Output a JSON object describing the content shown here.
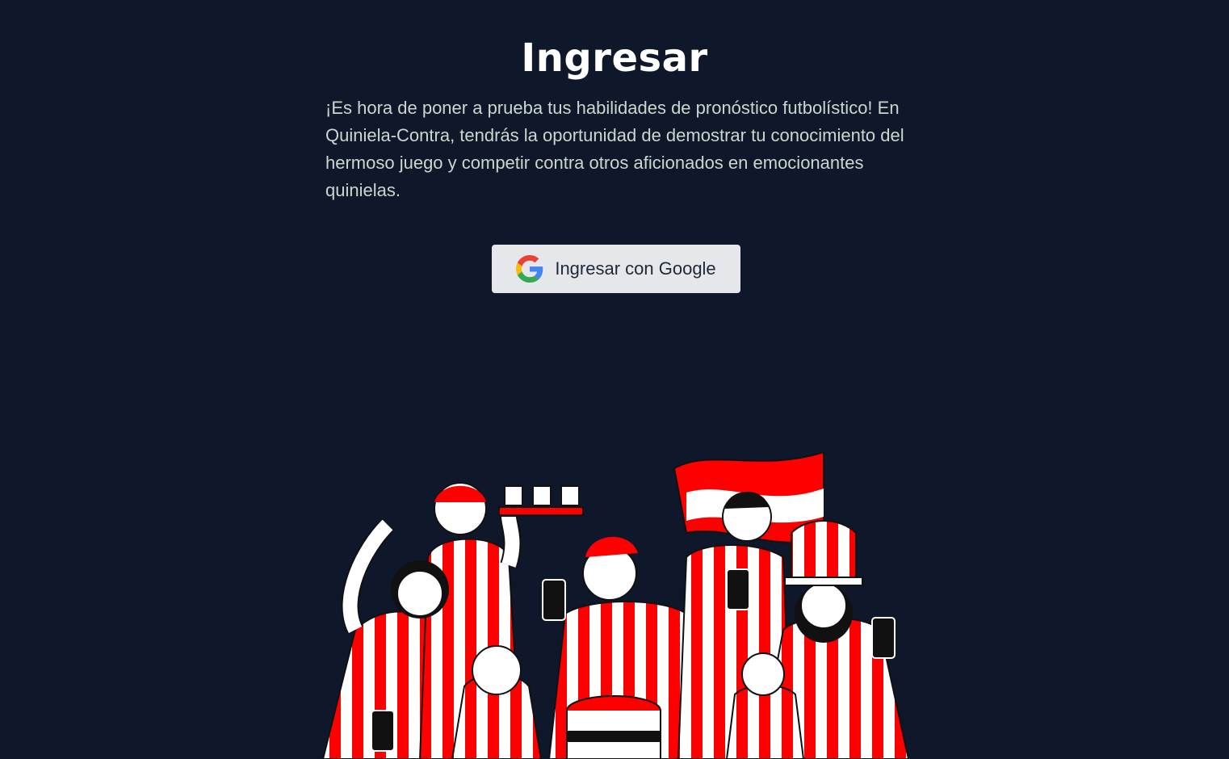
{
  "page": {
    "title": "Ingresar",
    "description": "¡Es hora de poner a prueba tus habilidades de pronóstico futbolístico! En Quiniela-Contra, tendrás la oportunidad de demostrar tu conocimiento del hermoso juego y competir contra otros aficionados en emocionantes quinielas."
  },
  "login": {
    "google_button_label": "Ingresar con Google",
    "icon": "google-icon"
  },
  "illustration": {
    "subject": "football-fans-crowd-illustration"
  },
  "colors": {
    "background": "#0f172a",
    "title": "#ffffff",
    "text": "#c9d8cd",
    "button_bg": "#e5e7eb",
    "accent_red": "#ff0000"
  }
}
